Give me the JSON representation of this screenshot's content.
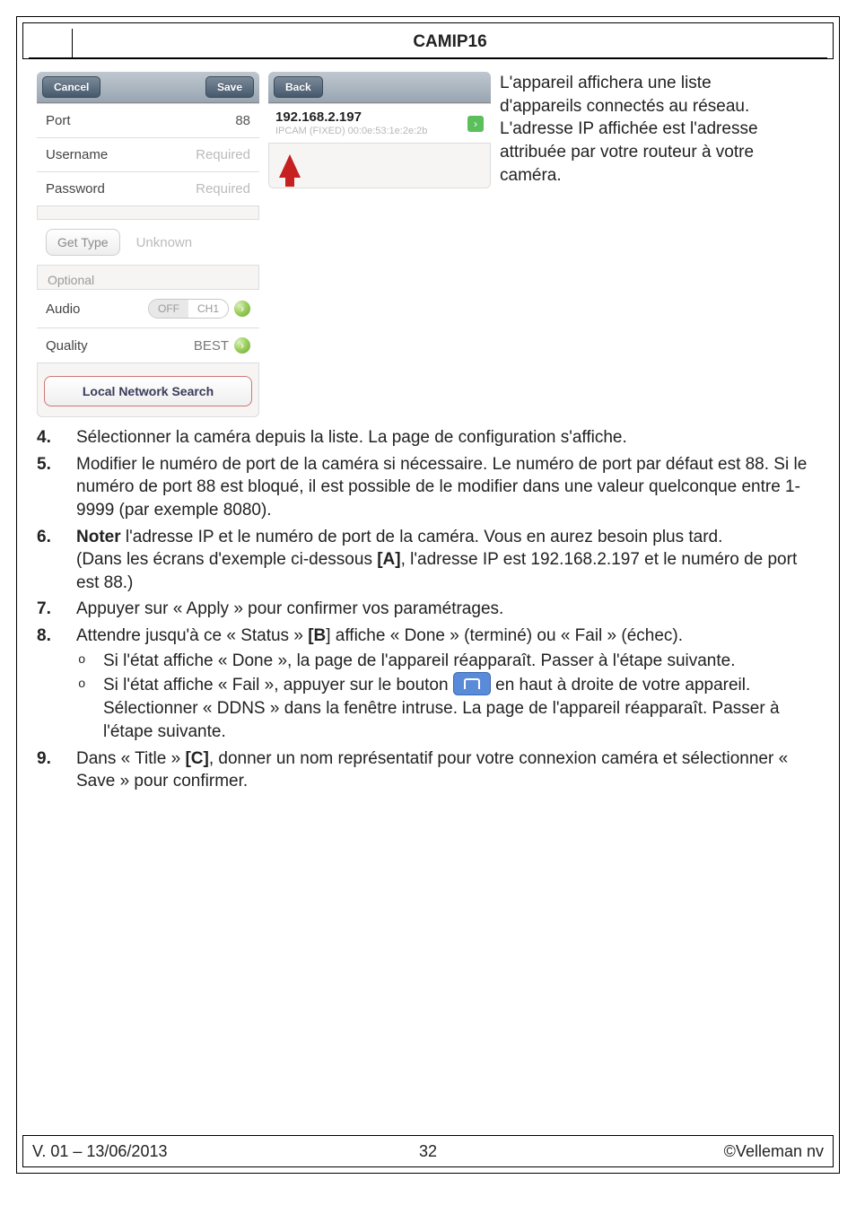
{
  "header": {
    "title": "CAMIP16"
  },
  "panel_left": {
    "nav": {
      "cancel": "Cancel",
      "save": "Save"
    },
    "rows": {
      "port": {
        "label": "Port",
        "value": "88"
      },
      "username": {
        "label": "Username",
        "value": "Required"
      },
      "password": {
        "label": "Password",
        "value": "Required"
      },
      "gettype": {
        "button": "Get Type",
        "value": "Unknown"
      },
      "optional": "Optional",
      "audio": {
        "label": "Audio",
        "seg_off": "OFF",
        "seg_ch1": "CH1"
      },
      "quality": {
        "label": "Quality",
        "value": "BEST"
      }
    },
    "search_btn": "Local Network Search"
  },
  "panel_right": {
    "nav": {
      "back": "Back"
    },
    "row": {
      "ip": "192.168.2.197",
      "sub": "IPCAM (FIXED)   00:0e:53:1e:2e:2b"
    }
  },
  "intro": "L'appareil affichera une liste d'appareils connectés au réseau. L'adresse IP affichée est l'adresse attribuée par votre routeur à votre caméra.",
  "steps": {
    "s4": "Sélectionner la caméra depuis la liste. La page de configuration s'affiche.",
    "s5": "Modifier le numéro de port de la caméra si nécessaire. Le numéro de port par défaut est 88. Si le numéro de port 88 est bloqué, il est possible de le modifier dans une valeur quelconque entre 1-9999 (par exemple 8080).",
    "s6a": "Noter",
    "s6b": " l'adresse IP et le numéro de port de la caméra. Vous en aurez besoin plus tard.",
    "s6c": "(Dans les écrans d'exemple ci-dessous ",
    "s6d": "[A]",
    "s6e": ", l'adresse IP est 192.168.2.197 et le numéro de port est 88.)",
    "s7": "Appuyer sur « Apply » pour confirmer vos paramétrages.",
    "s8a": "Attendre jusqu'à ce « Status » ",
    "s8b": "[B",
    "s8c": "] affiche « Done » (terminé) ou « Fail » (échec).",
    "s8_o1": "Si l'état affiche « Done », la page de l'appareil réapparaît. Passer à l'étape suivante.",
    "s8_o2a": "Si l'état affiche « Fail », appuyer sur le bouton ",
    "s8_o2b": " en haut à droite de votre appareil. Sélectionner « DDNS » dans la fenêtre intruse. La page de l'appareil réapparaît. Passer à l'étape suivante.",
    "s9a": "Dans « Title » ",
    "s9b": "[C]",
    "s9c": ", donner un nom représentatif pour votre connexion caméra et sélectionner « Save » pour confirmer."
  },
  "footer": {
    "left": "V. 01 – 13/06/2013",
    "center": "32",
    "right": "©Velleman nv"
  }
}
